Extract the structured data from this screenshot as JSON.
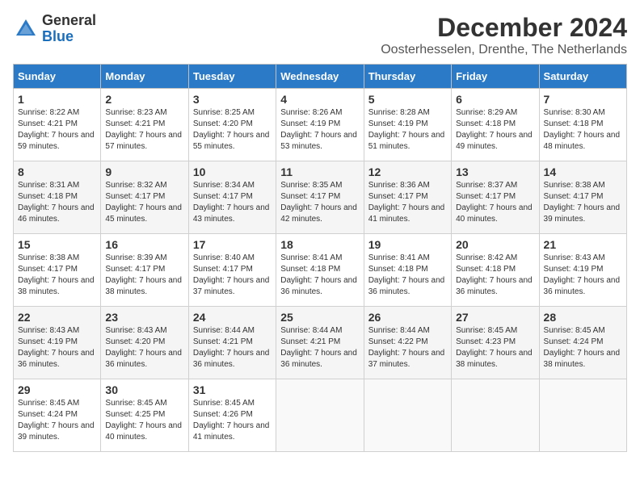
{
  "header": {
    "logo_line1": "General",
    "logo_line2": "Blue",
    "month_title": "December 2024",
    "location": "Oosterhesselen, Drenthe, The Netherlands"
  },
  "days_of_week": [
    "Sunday",
    "Monday",
    "Tuesday",
    "Wednesday",
    "Thursday",
    "Friday",
    "Saturday"
  ],
  "weeks": [
    [
      {
        "day": "1",
        "sunrise": "8:22 AM",
        "sunset": "4:21 PM",
        "daylight": "7 hours and 59 minutes."
      },
      {
        "day": "2",
        "sunrise": "8:23 AM",
        "sunset": "4:21 PM",
        "daylight": "7 hours and 57 minutes."
      },
      {
        "day": "3",
        "sunrise": "8:25 AM",
        "sunset": "4:20 PM",
        "daylight": "7 hours and 55 minutes."
      },
      {
        "day": "4",
        "sunrise": "8:26 AM",
        "sunset": "4:19 PM",
        "daylight": "7 hours and 53 minutes."
      },
      {
        "day": "5",
        "sunrise": "8:28 AM",
        "sunset": "4:19 PM",
        "daylight": "7 hours and 51 minutes."
      },
      {
        "day": "6",
        "sunrise": "8:29 AM",
        "sunset": "4:18 PM",
        "daylight": "7 hours and 49 minutes."
      },
      {
        "day": "7",
        "sunrise": "8:30 AM",
        "sunset": "4:18 PM",
        "daylight": "7 hours and 48 minutes."
      }
    ],
    [
      {
        "day": "8",
        "sunrise": "8:31 AM",
        "sunset": "4:18 PM",
        "daylight": "7 hours and 46 minutes."
      },
      {
        "day": "9",
        "sunrise": "8:32 AM",
        "sunset": "4:17 PM",
        "daylight": "7 hours and 45 minutes."
      },
      {
        "day": "10",
        "sunrise": "8:34 AM",
        "sunset": "4:17 PM",
        "daylight": "7 hours and 43 minutes."
      },
      {
        "day": "11",
        "sunrise": "8:35 AM",
        "sunset": "4:17 PM",
        "daylight": "7 hours and 42 minutes."
      },
      {
        "day": "12",
        "sunrise": "8:36 AM",
        "sunset": "4:17 PM",
        "daylight": "7 hours and 41 minutes."
      },
      {
        "day": "13",
        "sunrise": "8:37 AM",
        "sunset": "4:17 PM",
        "daylight": "7 hours and 40 minutes."
      },
      {
        "day": "14",
        "sunrise": "8:38 AM",
        "sunset": "4:17 PM",
        "daylight": "7 hours and 39 minutes."
      }
    ],
    [
      {
        "day": "15",
        "sunrise": "8:38 AM",
        "sunset": "4:17 PM",
        "daylight": "7 hours and 38 minutes."
      },
      {
        "day": "16",
        "sunrise": "8:39 AM",
        "sunset": "4:17 PM",
        "daylight": "7 hours and 38 minutes."
      },
      {
        "day": "17",
        "sunrise": "8:40 AM",
        "sunset": "4:17 PM",
        "daylight": "7 hours and 37 minutes."
      },
      {
        "day": "18",
        "sunrise": "8:41 AM",
        "sunset": "4:18 PM",
        "daylight": "7 hours and 36 minutes."
      },
      {
        "day": "19",
        "sunrise": "8:41 AM",
        "sunset": "4:18 PM",
        "daylight": "7 hours and 36 minutes."
      },
      {
        "day": "20",
        "sunrise": "8:42 AM",
        "sunset": "4:18 PM",
        "daylight": "7 hours and 36 minutes."
      },
      {
        "day": "21",
        "sunrise": "8:43 AM",
        "sunset": "4:19 PM",
        "daylight": "7 hours and 36 minutes."
      }
    ],
    [
      {
        "day": "22",
        "sunrise": "8:43 AM",
        "sunset": "4:19 PM",
        "daylight": "7 hours and 36 minutes."
      },
      {
        "day": "23",
        "sunrise": "8:43 AM",
        "sunset": "4:20 PM",
        "daylight": "7 hours and 36 minutes."
      },
      {
        "day": "24",
        "sunrise": "8:44 AM",
        "sunset": "4:21 PM",
        "daylight": "7 hours and 36 minutes."
      },
      {
        "day": "25",
        "sunrise": "8:44 AM",
        "sunset": "4:21 PM",
        "daylight": "7 hours and 36 minutes."
      },
      {
        "day": "26",
        "sunrise": "8:44 AM",
        "sunset": "4:22 PM",
        "daylight": "7 hours and 37 minutes."
      },
      {
        "day": "27",
        "sunrise": "8:45 AM",
        "sunset": "4:23 PM",
        "daylight": "7 hours and 38 minutes."
      },
      {
        "day": "28",
        "sunrise": "8:45 AM",
        "sunset": "4:24 PM",
        "daylight": "7 hours and 38 minutes."
      }
    ],
    [
      {
        "day": "29",
        "sunrise": "8:45 AM",
        "sunset": "4:24 PM",
        "daylight": "7 hours and 39 minutes."
      },
      {
        "day": "30",
        "sunrise": "8:45 AM",
        "sunset": "4:25 PM",
        "daylight": "7 hours and 40 minutes."
      },
      {
        "day": "31",
        "sunrise": "8:45 AM",
        "sunset": "4:26 PM",
        "daylight": "7 hours and 41 minutes."
      },
      null,
      null,
      null,
      null
    ]
  ],
  "labels": {
    "sunrise": "Sunrise:",
    "sunset": "Sunset:",
    "daylight": "Daylight:"
  }
}
